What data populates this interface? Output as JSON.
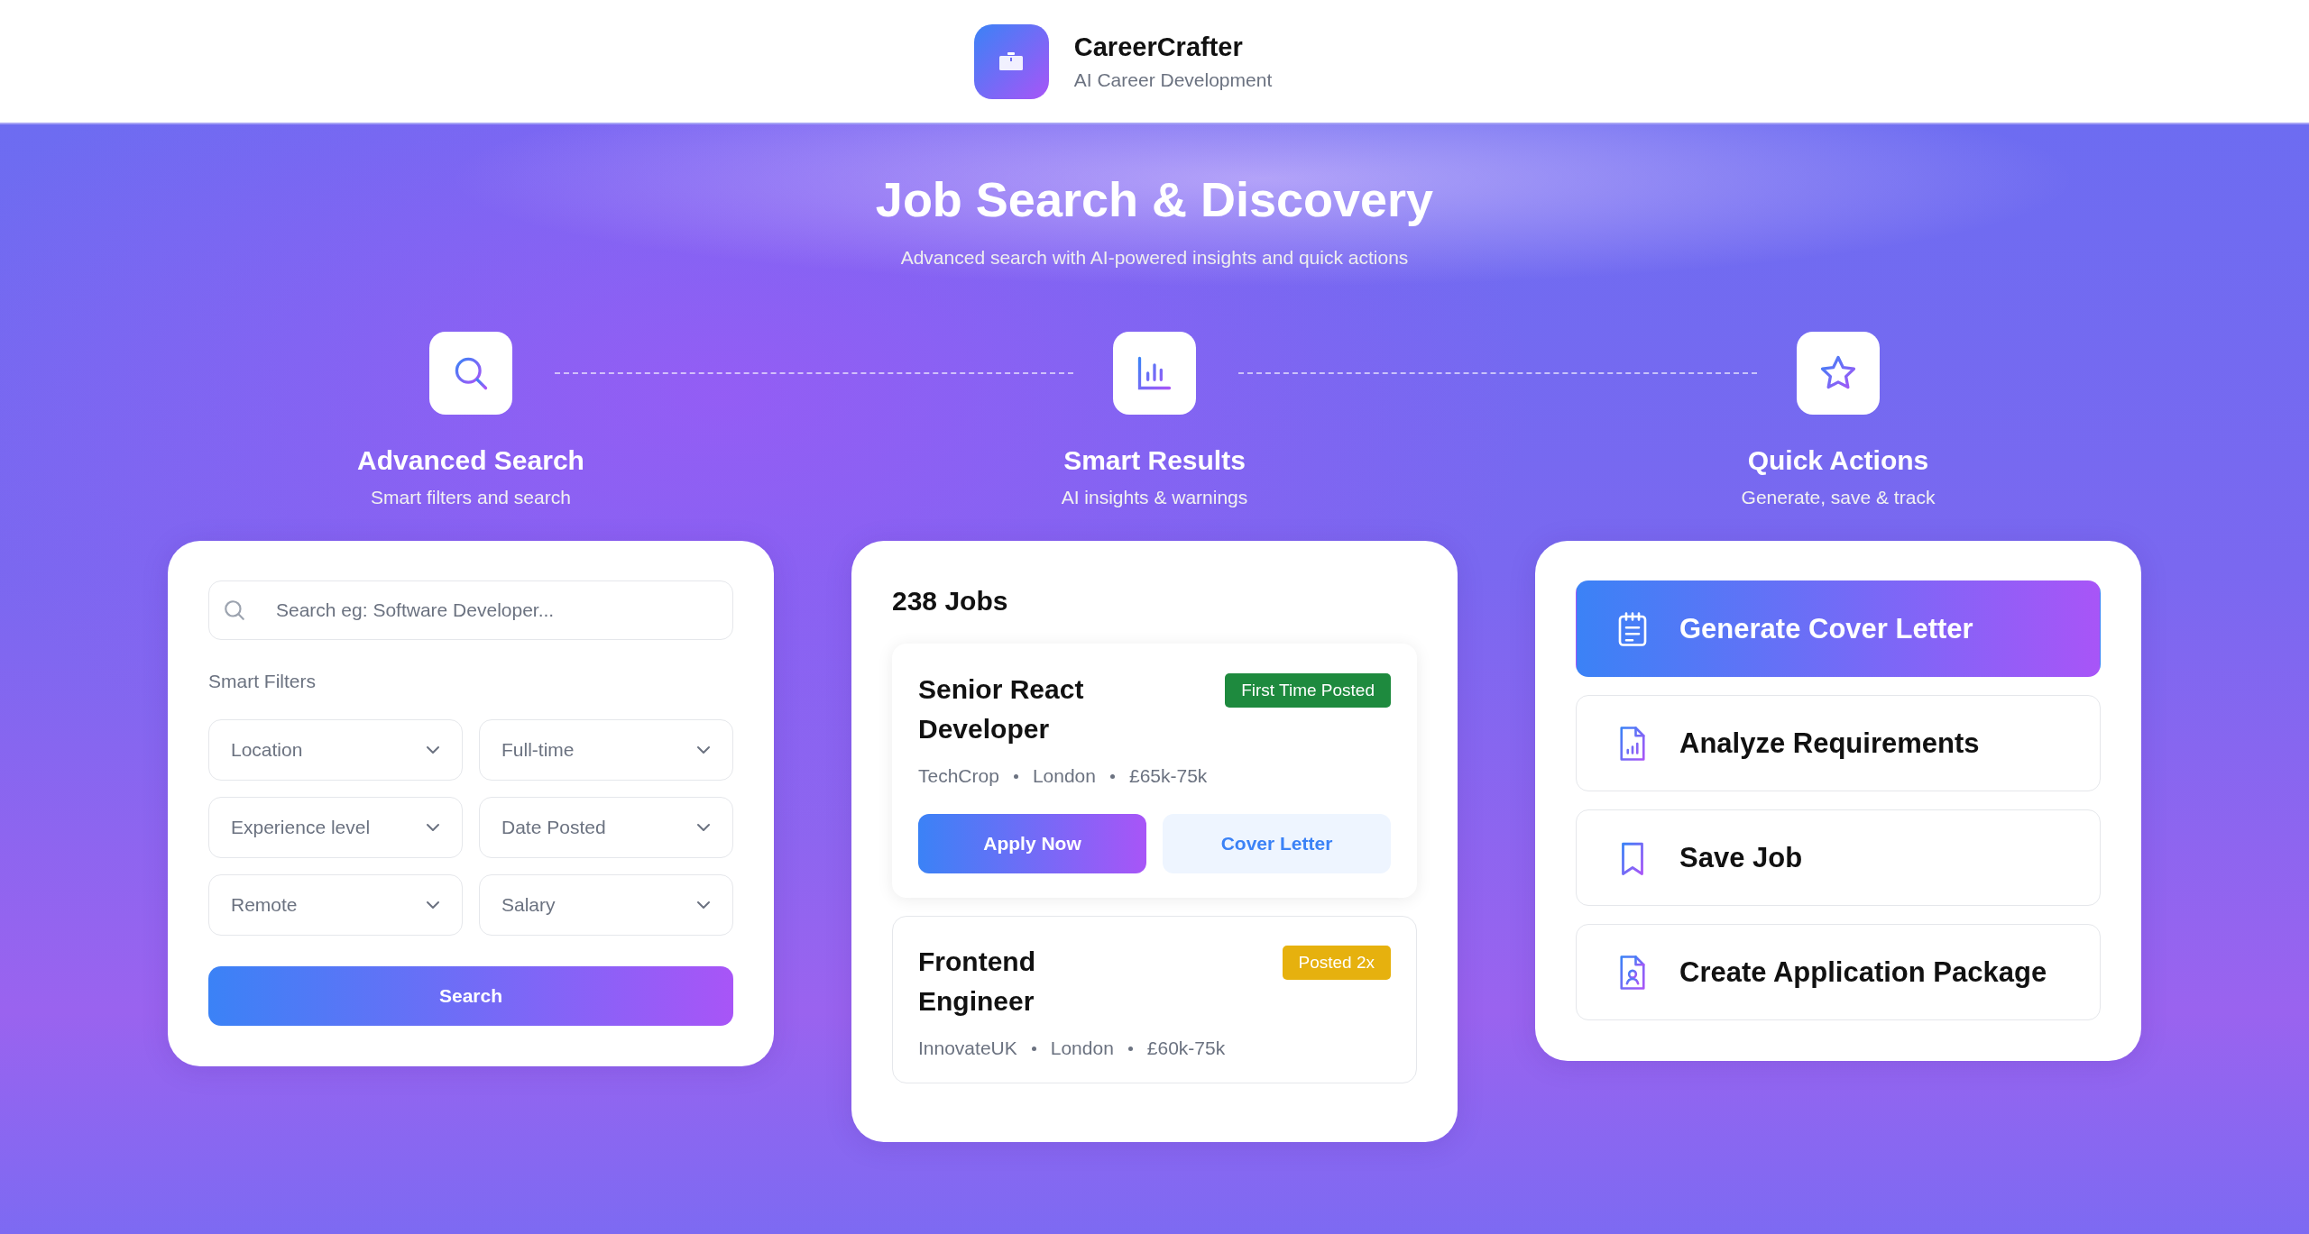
{
  "brand": {
    "name": "CareerCrafter",
    "tagline": "AI Career Development"
  },
  "hero": {
    "title": "Job Search & Discovery",
    "subtitle": "Advanced search with AI-powered insights and quick actions"
  },
  "steps": [
    {
      "kind": "search",
      "title": "Advanced Search",
      "subtitle": "Smart filters and search"
    },
    {
      "kind": "chart",
      "title": "Smart Results",
      "subtitle": "AI insights & warnings"
    },
    {
      "kind": "star",
      "title": "Quick Actions",
      "subtitle": "Generate, save & track"
    }
  ],
  "search_panel": {
    "search": {
      "placeholder": "Search eg: Software Developer..."
    },
    "filters_label": "Smart Filters",
    "filters": [
      "Location",
      "Full-time",
      "Experience level",
      "Date Posted",
      "Remote",
      "Salary"
    ],
    "button": "Search"
  },
  "results": {
    "count": "238 Jobs",
    "jobs": [
      {
        "title": "Senior React Developer",
        "badge": "First Time Posted",
        "color": "#1e8a3e",
        "meta": [
          "TechCrop",
          "London",
          "£65k-75k"
        ],
        "expanded": true,
        "actions": [
          "Apply Now",
          "Cover Letter"
        ]
      },
      {
        "title": "Frontend Engineer",
        "badge": "Posted 2x",
        "color": "#e6b10e",
        "meta": [
          "InnovateUK",
          "London",
          "£60k-75k"
        ],
        "expanded": false
      }
    ]
  },
  "quick_actions": [
    {
      "kind": "cover-letter",
      "label": "Generate Cover Letter",
      "selected": true
    },
    {
      "kind": "analyze",
      "label": "Analyze Requirements",
      "selected": false
    },
    {
      "kind": "save",
      "label": "Save Job",
      "selected": false
    },
    {
      "kind": "package",
      "label": "Create Application Package",
      "selected": false
    }
  ]
}
